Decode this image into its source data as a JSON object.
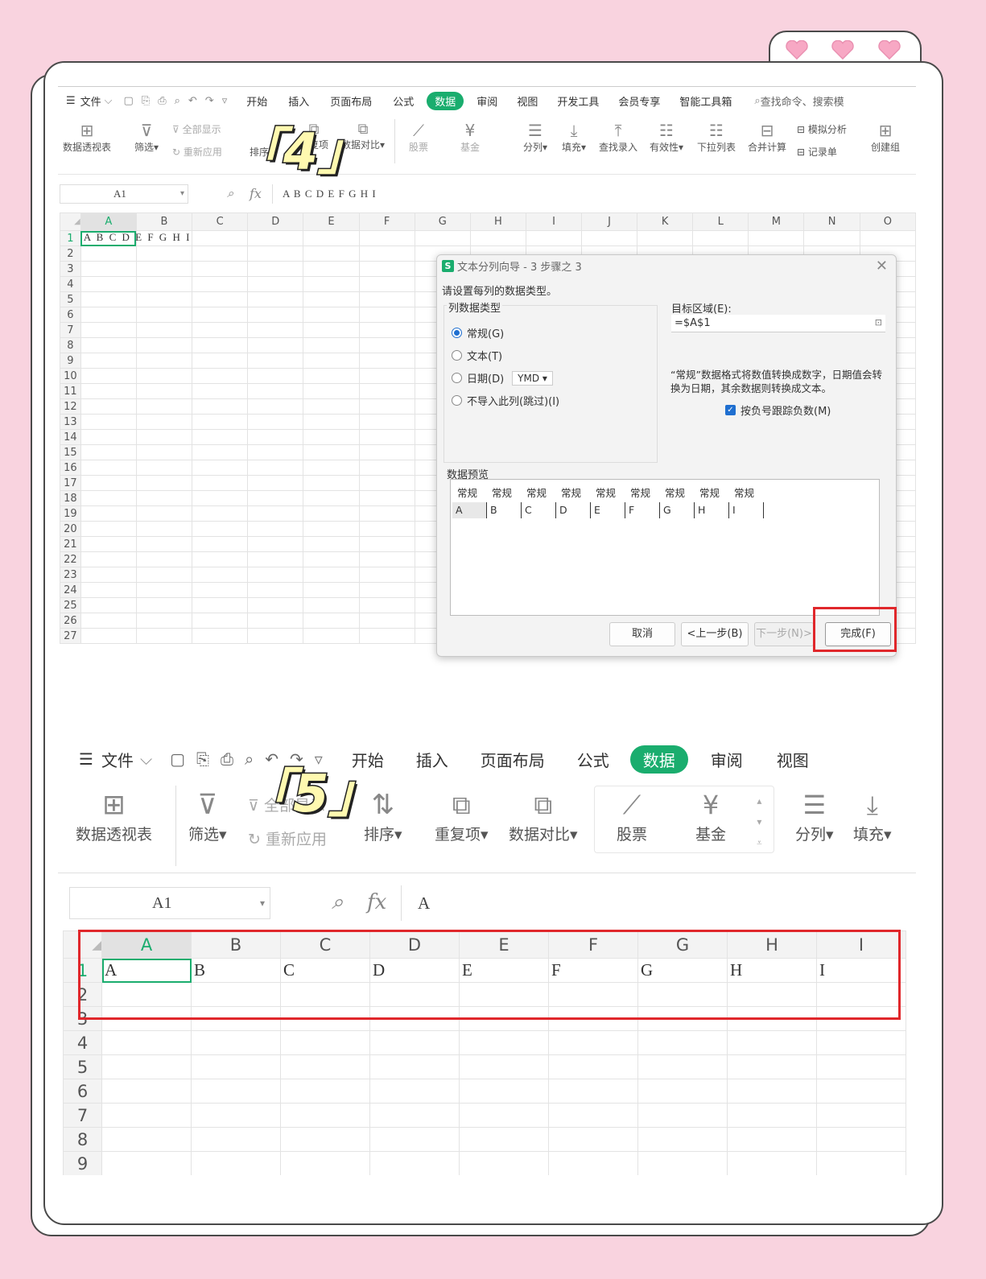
{
  "tags": {
    "step4": "「4」",
    "step5": "「5」"
  },
  "colors": {
    "accent": "#1aad6e",
    "highlight": "#e0272b",
    "background": "#f9d3df"
  },
  "ribbon1": {
    "menu": [
      "文件",
      "开始",
      "插入",
      "页面布局",
      "公式",
      "数据",
      "审阅",
      "视图",
      "开发工具",
      "会员专享",
      "智能工具箱"
    ],
    "active_tab": "数据",
    "search": "查找命令、搜索模",
    "buttons": [
      "数据透视表",
      "筛选",
      "全部显示",
      "重新应用",
      "排序",
      "重复项",
      "数据对比",
      "股票",
      "基金",
      "分列",
      "填充",
      "查找录入",
      "有效性",
      "下拉列表",
      "合并计算",
      "模拟分析",
      "记录单",
      "创建组"
    ]
  },
  "sheet1": {
    "name_box": "A1",
    "formula": "A B C D E F G H I",
    "columns": [
      "A",
      "B",
      "C",
      "D",
      "E",
      "F",
      "G",
      "H",
      "I",
      "J",
      "K",
      "L",
      "M",
      "N",
      "O"
    ],
    "rows": [
      "1",
      "2",
      "3",
      "4",
      "5",
      "6",
      "7",
      "8",
      "9",
      "10",
      "11",
      "12",
      "13",
      "14",
      "15",
      "16",
      "17",
      "18",
      "19",
      "20",
      "21",
      "22",
      "23",
      "24",
      "25",
      "26",
      "27"
    ],
    "a1_value": "A B C D E F G H I"
  },
  "dialog": {
    "title": "文本分列向导 - 3 步骤之 3",
    "prompt": "请设置每列的数据类型。",
    "group_label": "列数据类型",
    "options": [
      "常规(G)",
      "文本(T)",
      "日期(D)",
      "不导入此列(跳过)(I)"
    ],
    "date_format": "YMD",
    "target_label": "目标区域(E):",
    "target_value": "=$A$1",
    "description": "“常规”数据格式将数值转换成数字，日期值会转换为日期，其余数据则转换成文本。",
    "checkbox_label": "按负号跟踪负数(M)",
    "preview_label": "数据预览",
    "preview_headers": [
      "常规",
      "常规",
      "常规",
      "常规",
      "常规",
      "常规",
      "常规",
      "常规",
      "常规"
    ],
    "preview_values": [
      "A",
      "B",
      "C",
      "D",
      "E",
      "F",
      "G",
      "H",
      "I"
    ],
    "buttons": {
      "cancel": "取消",
      "back": "<上一步(B)",
      "next": "下一步(N)>",
      "finish": "完成(F)"
    }
  },
  "ribbon2": {
    "menu": [
      "文件",
      "开始",
      "插入",
      "页面布局",
      "公式",
      "数据",
      "审阅",
      "视图"
    ],
    "buttons": [
      "数据透视表",
      "筛选",
      "全部显示",
      "重新应用",
      "排序",
      "重复项",
      "数据对比",
      "股票",
      "基金",
      "分列",
      "填充"
    ]
  },
  "sheet2": {
    "name_box": "A1",
    "formula": "A",
    "columns": [
      "A",
      "B",
      "C",
      "D",
      "E",
      "F",
      "G",
      "H",
      "I"
    ],
    "rows": [
      "1",
      "2",
      "3",
      "4",
      "5",
      "6",
      "7",
      "8",
      "9"
    ],
    "row1": [
      "A",
      "B",
      "C",
      "D",
      "E",
      "F",
      "G",
      "H",
      "I"
    ]
  }
}
